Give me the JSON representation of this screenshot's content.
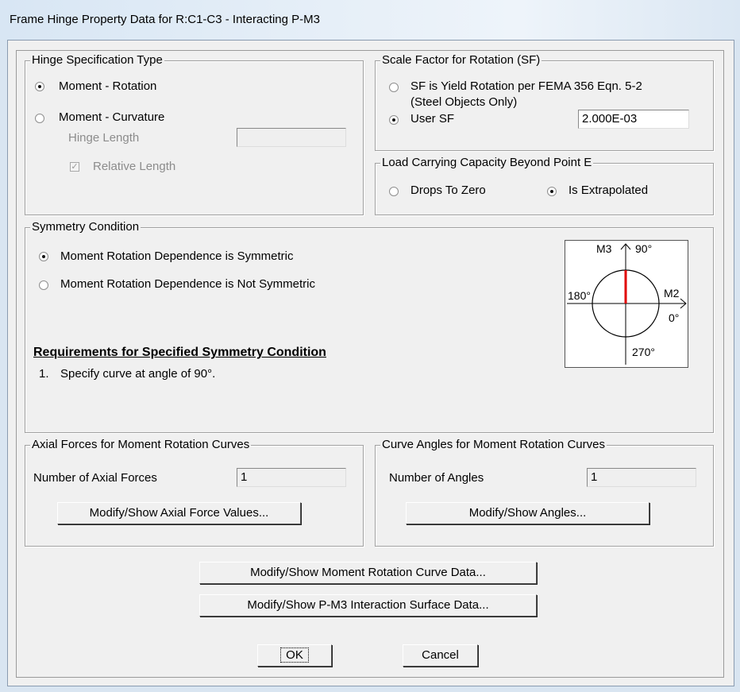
{
  "window": {
    "title": "Frame Hinge Property Data for R:C1-C3 - Interacting P-M3"
  },
  "hinge_spec": {
    "legend": "Hinge Specification Type",
    "moment_rotation": "Moment - Rotation",
    "moment_curvature": "Moment - Curvature",
    "hinge_length_label": "Hinge Length",
    "hinge_length_value": "",
    "relative_length": "Relative Length",
    "selected": "Moment - Rotation"
  },
  "scale_factor": {
    "legend": "Scale Factor for Rotation (SF)",
    "fema_line1": "SF is Yield Rotation per FEMA 356 Eqn. 5-2",
    "fema_line2": "(Steel Objects Only)",
    "user_sf": "User SF",
    "user_sf_value": "2.000E-03",
    "selected": "User SF"
  },
  "load_capacity": {
    "legend": "Load Carrying Capacity Beyond Point E",
    "drops_to_zero": "Drops To Zero",
    "is_extrapolated": "Is Extrapolated",
    "selected": "Is Extrapolated"
  },
  "symmetry": {
    "legend": "Symmetry Condition",
    "symmetric": "Moment Rotation Dependence is Symmetric",
    "not_symmetric": "Moment Rotation Dependence is Not Symmetric",
    "selected": "Moment Rotation Dependence is Symmetric",
    "requirements_title": "Requirements for Specified Symmetry Condition",
    "requirement_num": "1.",
    "requirement_1": "Specify curve at angle of 90°.",
    "diagram": {
      "m3": "M3",
      "deg90": "90°",
      "deg180": "180°",
      "m2": "M2",
      "deg0": "0°",
      "deg270": "270°",
      "highlight_color": "#e00000"
    }
  },
  "axial_forces": {
    "legend": "Axial Forces for Moment Rotation Curves",
    "count_label": "Number of Axial Forces",
    "count_value": "1",
    "button": "Modify/Show Axial Force Values..."
  },
  "curve_angles": {
    "legend": "Curve Angles for Moment Rotation Curves",
    "count_label": "Number of Angles",
    "count_value": "1",
    "button": "Modify/Show Angles..."
  },
  "buttons": {
    "curve_data": "Modify/Show Moment Rotation Curve Data...",
    "interaction_surface": "Modify/Show P-M3 Interaction Surface Data...",
    "ok": "OK",
    "cancel": "Cancel"
  }
}
